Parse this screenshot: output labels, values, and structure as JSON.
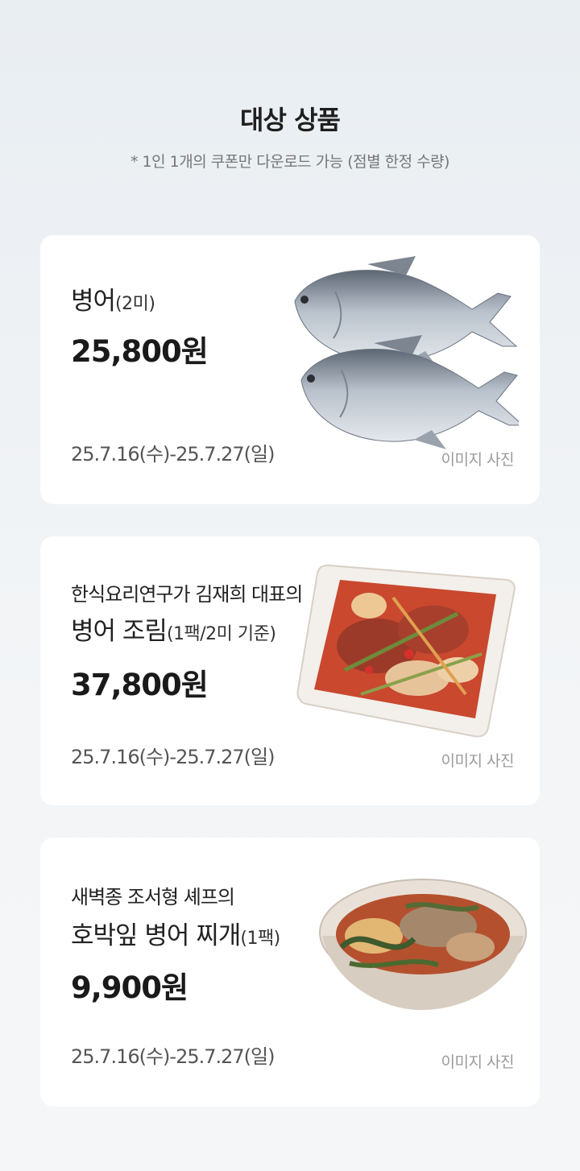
{
  "header": {
    "title": "대상 상품",
    "subtitle": "* 1인 1개의 쿠폰만 다운로드 가능 (점별 한정 수량)"
  },
  "products": [
    {
      "name_prefix": "",
      "name": "병어",
      "qty": "(2미)",
      "price": "25,800원",
      "period": "25.7.16(수)-25.7.27(일)",
      "image_label": "이미지 사진"
    },
    {
      "name_prefix": "한식요리연구가 김재희 대표의",
      "name": "병어 조림",
      "qty": "(1팩/2미 기준)",
      "price": "37,800원",
      "period": "25.7.16(수)-25.7.27(일)",
      "image_label": "이미지 사진"
    },
    {
      "name_prefix": "새벽종 조서형 셰프의",
      "name": "호박잎 병어 찌개",
      "qty": "(1팩)",
      "price": "9,900원",
      "period": "25.7.16(수)-25.7.27(일)",
      "image_label": "이미지 사진"
    }
  ]
}
